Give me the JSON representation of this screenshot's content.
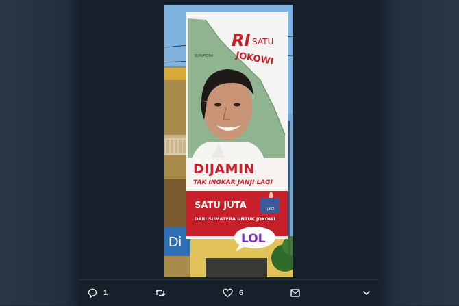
{
  "billboard": {
    "brand_top": "RI",
    "brand_satu": "SATU",
    "brand_name": "JOKOWI",
    "map_label": "SUMATERA",
    "headline": "DIJAMIN",
    "subheadline": "TAK INGKAR JANJI LAGI",
    "satu_juta": "SATU JUTA",
    "like_badge": "LIKE",
    "tagline": "DARI SUMATERA UNTUK JOKOWI"
  },
  "sticker": {
    "text": "LOL"
  },
  "storefront_sign": "Di",
  "actions": {
    "reply_count": "1",
    "like_count": "6"
  },
  "colors": {
    "panel_bg": "#15202b",
    "billboard_red": "#c8202b",
    "map_green": "#8fb48f",
    "sticker_purple": "#7b2fbf"
  }
}
